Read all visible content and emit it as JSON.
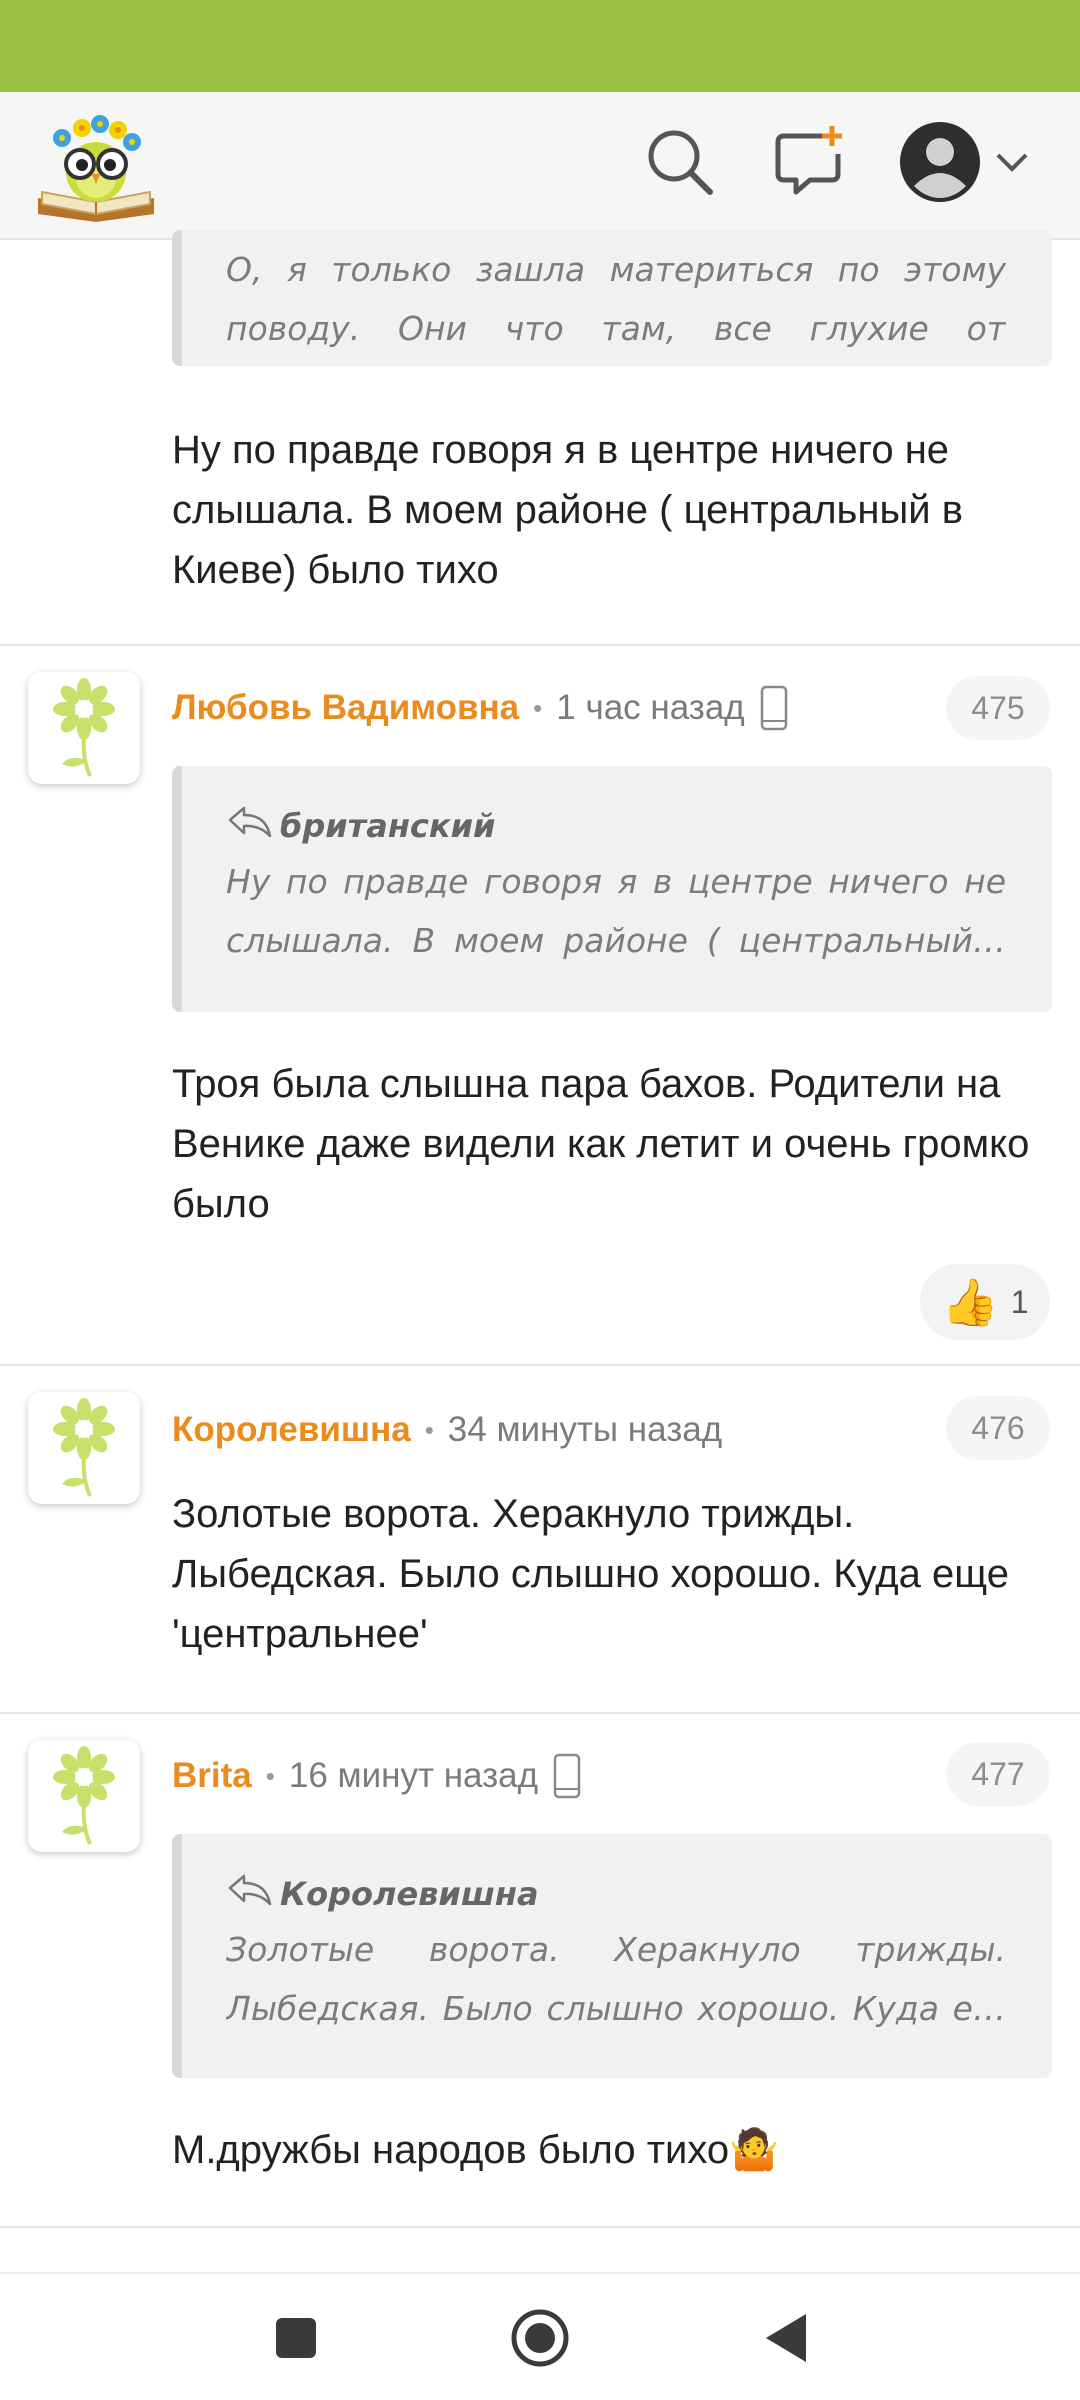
{
  "header": {
    "logo": "owl-book-logo",
    "icons": [
      "search-icon",
      "new-post-icon",
      "user-avatar-icon",
      "chevron-down-icon"
    ]
  },
  "comments": [
    {
      "quote_text": "О, я только зашла материться по этому поводу. Они что там, все глухие от рожден…",
      "text": "Ну по правде говоря я в центре ничего не слышала. В моем районе ( центральный в Киеве) было тихо"
    },
    {
      "author": "Любовь Вадимовна",
      "time": "1 час назад",
      "device_icon": "mobile-phone-icon",
      "number": "475",
      "quote_author": "британский",
      "quote_text": "Ну по правде говоря я в центре ничего не слышала. В моем районе ( центральный…",
      "text": "Троя была слышна пара бахов. Родители на Венике даже видели как летит и очень громко было",
      "reaction": {
        "emoji": "👍",
        "count": "1"
      }
    },
    {
      "author": "Королевишна",
      "time": "34 минуты назад",
      "number": "476",
      "text": "Золотые ворота. Херакнуло трижды. Лыбедская. Было слышно хорошо. Куда еще 'центральнее'"
    },
    {
      "author": "Brita",
      "time": "16 минут назад",
      "device_icon": "mobile-phone-icon",
      "number": "477",
      "quote_author": "Королевишна",
      "quote_text": "Золотые ворота. Херакнуло трижды. Лыбедская. Было слышно хорошо. Куда е…",
      "text": "М.дружбы народов было тихо🤷"
    }
  ],
  "colors": {
    "status_bar": "#9bc244",
    "author": "#e98c1d",
    "avatar_flower": "#c6e06a"
  },
  "navbar": {
    "buttons": [
      "recents-button",
      "home-button",
      "back-button"
    ]
  }
}
